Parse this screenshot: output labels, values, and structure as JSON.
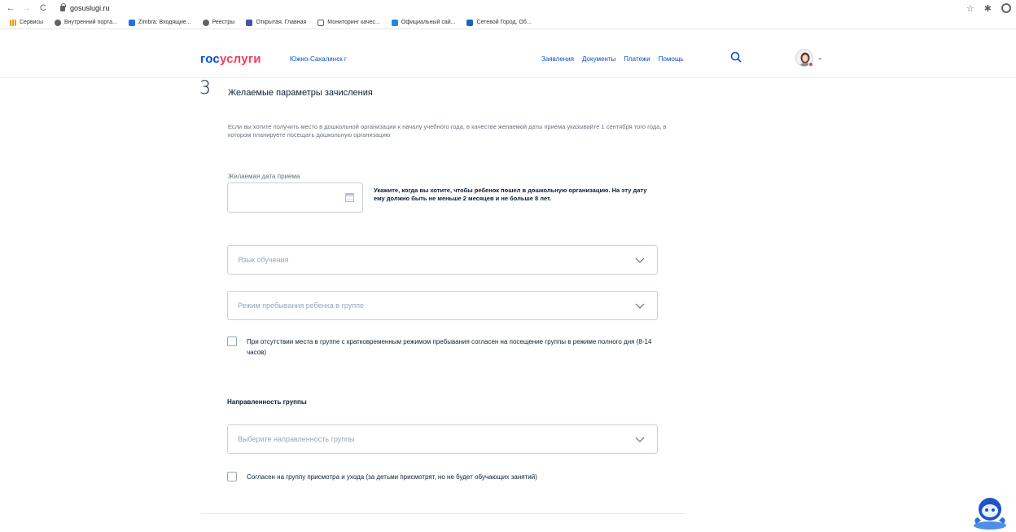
{
  "browser": {
    "back": "←",
    "forward": "→",
    "reload": "C",
    "url": "gosuslugi.ru",
    "star": "☆",
    "ext": "✱"
  },
  "bookmarks": [
    {
      "label": "Сервисы",
      "color": "#f29900"
    },
    {
      "label": "Внутренний порта...",
      "color": "#5f6368"
    },
    {
      "label": "Zimbra: Входящие...",
      "color": "#1a73e8"
    },
    {
      "label": "Реестры",
      "color": "#5f6368"
    },
    {
      "label": "Открытая. Главная",
      "color": "#3f51b5"
    },
    {
      "label": "Мониторинг качес...",
      "color": "#5f6368"
    },
    {
      "label": "Официальный сай...",
      "color": "#1e88e5"
    },
    {
      "label": "Сетевой Город. Об...",
      "color": "#1565c0"
    }
  ],
  "header": {
    "logo_part1": "гос",
    "logo_part2": "услуги",
    "city": "Южно-Сахалинск г",
    "menu": [
      "Заявления",
      "Документы",
      "Платежи",
      "Помощь"
    ]
  },
  "step": {
    "number": "3",
    "title": "Желаемые параметры зачисления",
    "hint": "Если вы хотите получить место в дошкольной организации к началу учебного года, в качестве желаемой даты приема указывайте 1 сентября того года, в котором планируете посещать дошкольную организацию"
  },
  "date_field": {
    "label": "Желаемая дата приема",
    "value": "",
    "note": "Укажите, когда вы хотите, чтобы ребенок пошел в дошкольную организацию. На эту дату ему должно быть не меньше 2 месяцев и не больше 8 лет."
  },
  "selects": {
    "language": "Язык обучения",
    "mode": "Режим пребывания ребенка в группе",
    "direction": "Выберите направленность группы"
  },
  "checkboxes": {
    "full_day": "При отсутствии места в группе с кратковременным режимом пребывания согласен на посещение группы в режиме полного дня (8-14 часов)",
    "care_group": "Согласен на группу присмотра и ухода (за детьми присмотрят, но не будет обучающих занятий)"
  },
  "section": {
    "direction_title": "Направленность группы"
  },
  "colors": {
    "brand_blue": "#0d4cd3",
    "brand_red": "#ee3f58"
  }
}
